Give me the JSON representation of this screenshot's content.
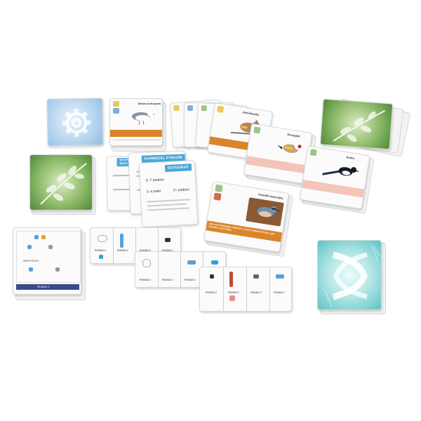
{
  "scene": {
    "background": "#ffffff",
    "accent_orange": "#d9852c",
    "accent_blue": "#3aa0d8",
    "accent_pink": "#f3c5b9"
  },
  "bird_cards": {
    "left_card_title": "Mewa srebrzysta",
    "fan_card_title": "Jemiołuszka",
    "goldfinch_title": "Szczygieł",
    "magpie_title": "Sroka",
    "nuthatch_title": "Kowalik zwyczajny",
    "nuthatch_power": "GDY AKTYWOWANE: ODRZUĆ 1 JAJO Z INNEGO PTAKA, ABY ZAGRAĆ 2 AKTYWUJ."
  },
  "bonus_cards": {
    "card1_title": "EKSPERT WSZYSTKO",
    "card2_title": "KARMICIEL PTAKÓW",
    "card3_title": "FOTOGRAF",
    "card3_line1": "5–7 ptaków",
    "card3_line2": "3–4 ptaki",
    "card3_line3": "2+ ptaków"
  },
  "goal_board": {
    "label_all": "WSZYSTKO",
    "footer": "RUNDA 1"
  },
  "round_strips": {
    "rounds": [
      "RUNDA 4",
      "RUNDA 3",
      "RUNDA 2",
      "RUNDA 1"
    ]
  }
}
